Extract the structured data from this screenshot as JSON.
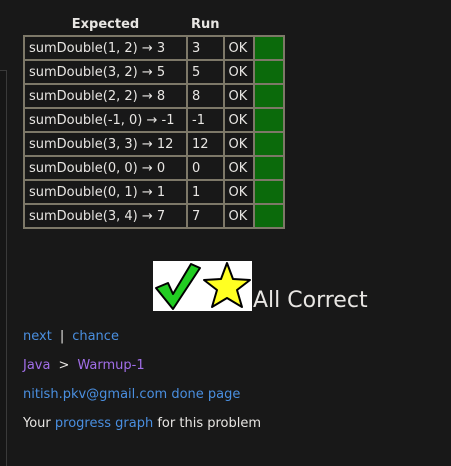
{
  "table": {
    "headers": {
      "expected": "Expected",
      "run": "Run"
    },
    "rows": [
      {
        "expected": "sumDouble(1, 2) → 3",
        "run": "3",
        "result": "OK"
      },
      {
        "expected": "sumDouble(3, 2) → 5",
        "run": "5",
        "result": "OK"
      },
      {
        "expected": "sumDouble(2, 2) → 8",
        "run": "8",
        "result": "OK"
      },
      {
        "expected": "sumDouble(-1, 0) → -1",
        "run": "-1",
        "result": "OK"
      },
      {
        "expected": "sumDouble(3, 3) → 12",
        "run": "12",
        "result": "OK"
      },
      {
        "expected": "sumDouble(0, 0) → 0",
        "run": "0",
        "result": "OK"
      },
      {
        "expected": "sumDouble(0, 1) → 1",
        "run": "1",
        "result": "OK"
      },
      {
        "expected": "sumDouble(3, 4) → 7",
        "run": "7",
        "result": "OK"
      }
    ],
    "status_color": "#0b6a0b"
  },
  "summary": {
    "text": "All Correct",
    "icons": [
      "checkmark-icon",
      "star-icon"
    ]
  },
  "nav": {
    "next": "next",
    "separator": "|",
    "chance": "chance"
  },
  "breadcrumb": {
    "language": "Java",
    "arrow": ">",
    "section": "Warmup-1"
  },
  "user": {
    "email_done": "nitish.pkv@gmail.com done page"
  },
  "progress": {
    "prefix": "Your",
    "link": "progress graph",
    "suffix": "for this problem"
  },
  "colors": {
    "link": "#4a8fe0",
    "breadcrumb": "#a16ee8",
    "background": "#181818"
  }
}
